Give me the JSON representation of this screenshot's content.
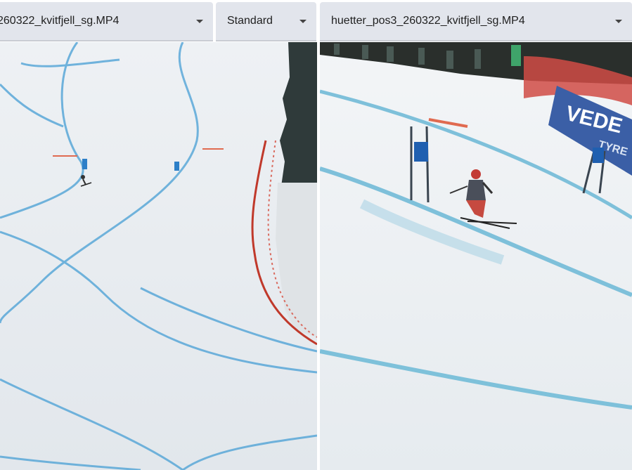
{
  "left_select": {
    "value": "260322_kvitfjell_sg.MP4",
    "icon": "chevron-down-icon"
  },
  "mode_select": {
    "value": "Standard",
    "icon": "chevron-down-icon"
  },
  "right_select": {
    "value": "huetter_pos3_260322_kvitfjell_sg.MP4",
    "icon": "chevron-down-icon"
  },
  "right_video": {
    "banner_text": "VEDE",
    "banner_subtext": "TYRE"
  },
  "colors": {
    "dropdown_bg": "#e2e5ec",
    "snow": "#e9eef2",
    "course_line": "#4aa3d6",
    "gate_blue": "#1f5fb0",
    "fence_red": "#c0392b",
    "banner_blue": "#3b5fa6"
  }
}
